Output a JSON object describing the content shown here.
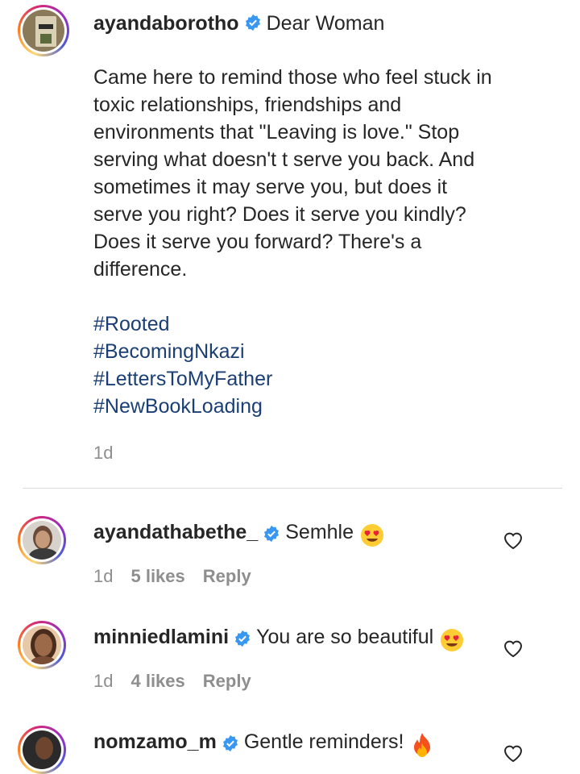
{
  "post": {
    "username": "ayandaborotho",
    "title": "Dear Woman",
    "caption": "Came here to remind those who feel stuck in\ntoxic relationships, friendships and\nenvironments that \"Leaving is love.\" Stop\nserving what doesn't t serve you back. And\nsometimes it may serve you, but does it\nserve you right? Does it serve you kindly?\nDoes it serve you forward? There's a\ndifference.",
    "hashtags": [
      "#Rooted",
      "#BecomingNkazi",
      "#LettersToMyFather",
      "#NewBookLoading"
    ],
    "time": "1d"
  },
  "comments": [
    {
      "username": "ayandathabethe_",
      "text": "Semhle",
      "emoji": "heart-eyes",
      "time": "1d",
      "likes": "5 likes",
      "reply": "Reply"
    },
    {
      "username": "minniedlamini",
      "text": "You are so beautiful",
      "emoji": "heart-eyes",
      "time": "1d",
      "likes": "4 likes",
      "reply": "Reply"
    },
    {
      "username": "nomzamo_m",
      "text": "Gentle reminders!",
      "emoji": "fire"
    }
  ],
  "colors": {
    "hashtag": "#1b3f74",
    "verified": "#3897f0",
    "muted": "#8e8e8e",
    "divider": "#dbdbdb"
  }
}
